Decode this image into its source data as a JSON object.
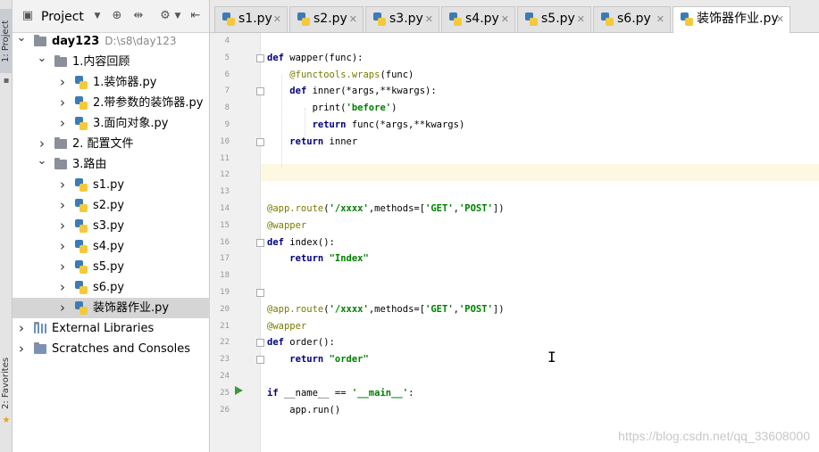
{
  "side_stripe": {
    "project_tab": "1: Project",
    "favorites_tab": "2: Favorites"
  },
  "project_panel": {
    "title": "Project",
    "tree": [
      {
        "label": "day123",
        "path": "D:\\s8\\day123",
        "kind": "folder",
        "depth": 0,
        "expanded": true,
        "bold": true
      },
      {
        "label": "1.内容回顾",
        "kind": "folder",
        "depth": 1,
        "expanded": true
      },
      {
        "label": "1.装饰器.py",
        "kind": "file",
        "depth": 2
      },
      {
        "label": "2.带参数的装饰器.py",
        "kind": "file",
        "depth": 2
      },
      {
        "label": "3.面向对象.py",
        "kind": "file",
        "depth": 2
      },
      {
        "label": "2. 配置文件",
        "kind": "folder",
        "depth": 1,
        "expanded": false
      },
      {
        "label": "3.路由",
        "kind": "folder",
        "depth": 1,
        "expanded": true
      },
      {
        "label": "s1.py",
        "kind": "file",
        "depth": 2
      },
      {
        "label": "s2.py",
        "kind": "file",
        "depth": 2
      },
      {
        "label": "s3.py",
        "kind": "file",
        "depth": 2
      },
      {
        "label": "s4.py",
        "kind": "file",
        "depth": 2
      },
      {
        "label": "s5.py",
        "kind": "file",
        "depth": 2
      },
      {
        "label": "s6.py",
        "kind": "file",
        "depth": 2
      },
      {
        "label": "装饰器作业.py",
        "kind": "file",
        "depth": 2,
        "selected": true
      },
      {
        "label": "External Libraries",
        "kind": "lib",
        "depth": 0,
        "expanded": false
      },
      {
        "label": "Scratches and Consoles",
        "kind": "scratch",
        "depth": 0,
        "expanded": false
      }
    ]
  },
  "tabs": [
    {
      "label": "s1.py"
    },
    {
      "label": "s2.py"
    },
    {
      "label": "s3.py"
    },
    {
      "label": "s4.py"
    },
    {
      "label": "s5.py"
    },
    {
      "label": "s6.py"
    },
    {
      "label": "装饰器作业.py",
      "active": true
    }
  ],
  "editor": {
    "current_line": 12,
    "lines": [
      {
        "n": "4",
        "code": ""
      },
      {
        "n": "5",
        "code": "def wapper(func):"
      },
      {
        "n": "6",
        "code": "    @functools.wraps(func)"
      },
      {
        "n": "7",
        "code": "    def inner(*args,**kwargs):"
      },
      {
        "n": "8",
        "code": "        print('before')"
      },
      {
        "n": "9",
        "code": "        return func(*args,**kwargs)"
      },
      {
        "n": "10",
        "code": "    return inner"
      },
      {
        "n": "11",
        "code": ""
      },
      {
        "n": "12",
        "code": ""
      },
      {
        "n": "13",
        "code": ""
      },
      {
        "n": "14",
        "code": "@app.route('/xxxx',methods=['GET','POST'])"
      },
      {
        "n": "15",
        "code": "@wapper"
      },
      {
        "n": "16",
        "code": "def index():"
      },
      {
        "n": "17",
        "code": "    return \"Index\""
      },
      {
        "n": "18",
        "code": ""
      },
      {
        "n": "19",
        "code": ""
      },
      {
        "n": "20",
        "code": "@app.route('/xxxx',methods=['GET','POST'])"
      },
      {
        "n": "21",
        "code": "@wapper"
      },
      {
        "n": "22",
        "code": "def order():"
      },
      {
        "n": "23",
        "code": "    return \"order\""
      },
      {
        "n": "24",
        "code": ""
      },
      {
        "n": "25",
        "code": "if __name__ == '__main__':"
      },
      {
        "n": "26",
        "code": "    app.run()"
      }
    ]
  },
  "watermark": "https://blog.csdn.net/qq_33608000"
}
